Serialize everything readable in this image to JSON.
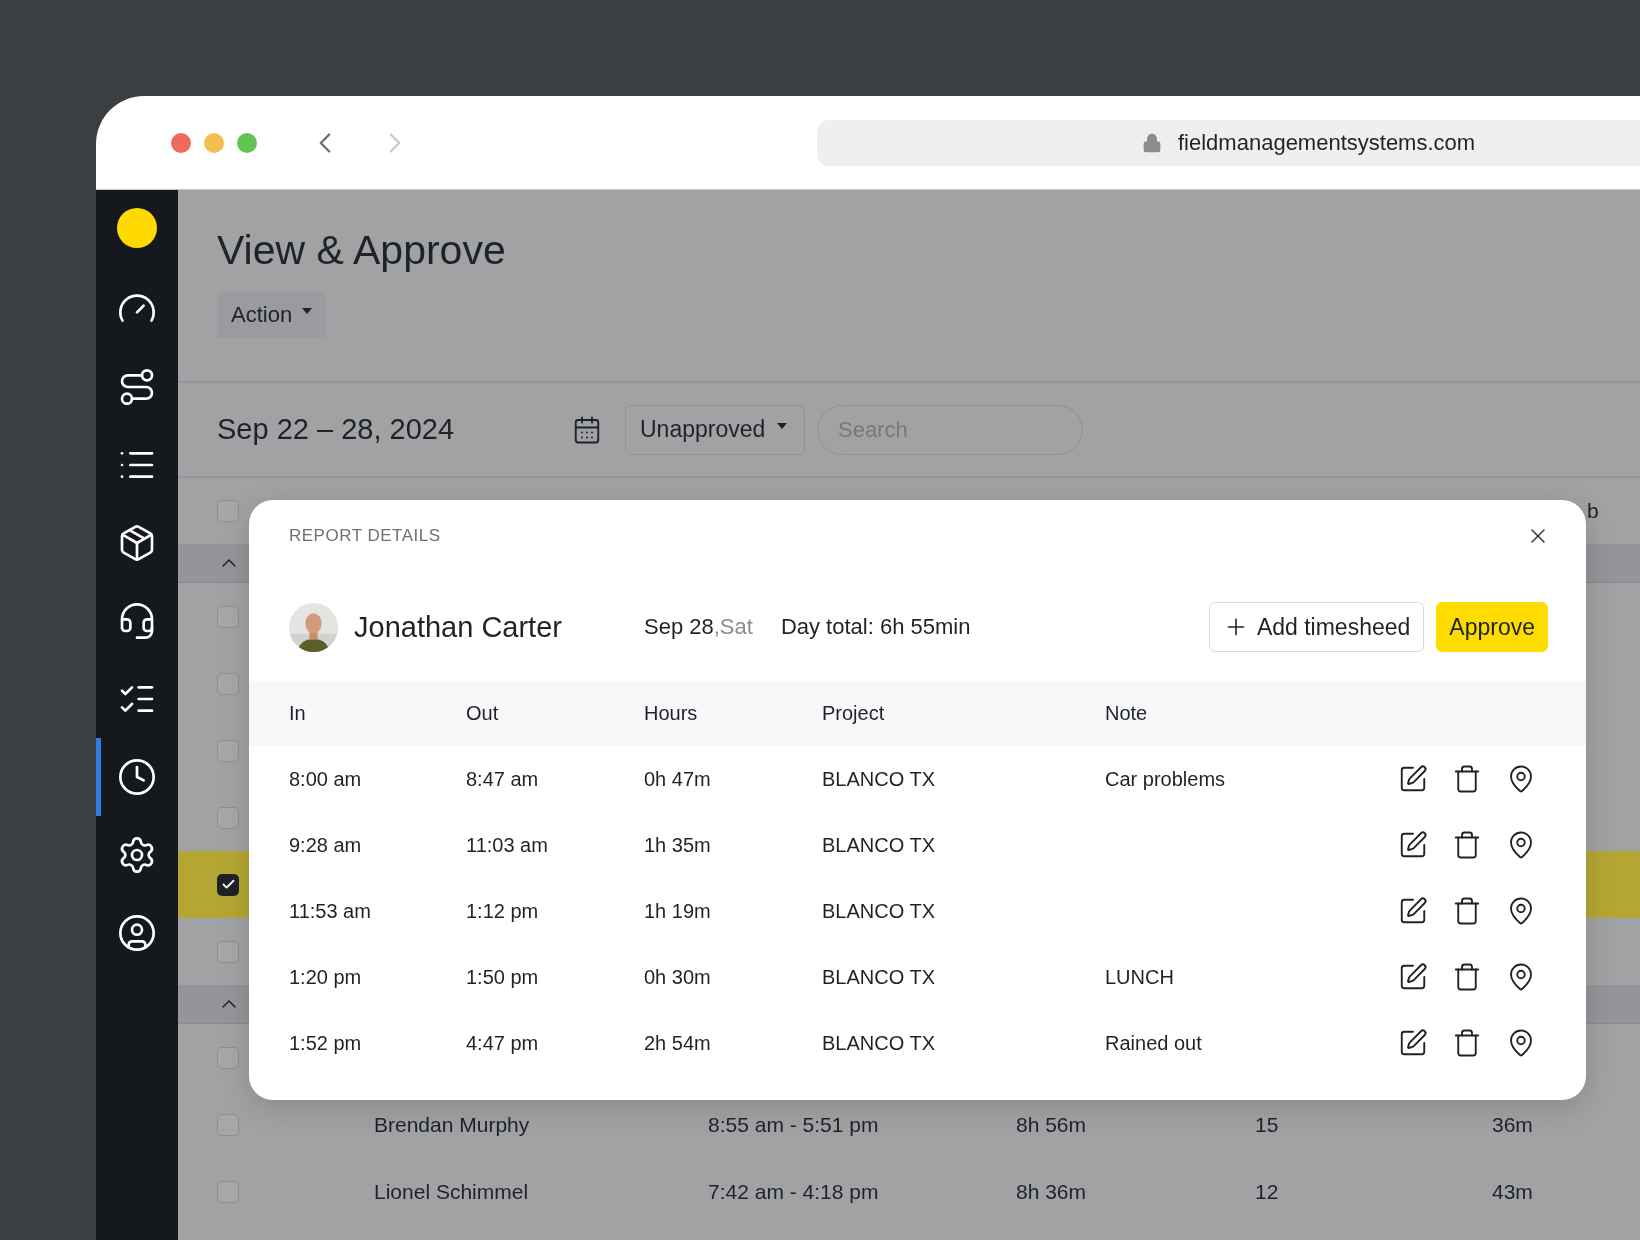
{
  "browser": {
    "url": "fieldmanagementsystems.com"
  },
  "sidebar": {
    "items": [
      {
        "kind": "dashboard",
        "selected": false
      },
      {
        "kind": "route",
        "selected": false
      },
      {
        "kind": "list",
        "selected": false
      },
      {
        "kind": "package",
        "selected": false
      },
      {
        "kind": "support",
        "selected": false
      },
      {
        "kind": "checklist",
        "selected": false
      },
      {
        "kind": "timesheet",
        "selected": true
      },
      {
        "kind": "settings",
        "selected": false
      },
      {
        "kind": "account",
        "selected": false
      }
    ]
  },
  "page": {
    "title": "View & Approve",
    "action_button": "Action"
  },
  "toolbar": {
    "date_range": "Sep 22 – 28, 2024",
    "status_filter": "Unapproved",
    "search": {
      "placeholder": "Search"
    }
  },
  "table": {
    "rows": [
      {
        "kind": "header",
        "checked": false,
        "label": "b"
      },
      {
        "kind": "group",
        "expanded": true
      },
      {
        "kind": "row",
        "checked": false,
        "selected": false
      },
      {
        "kind": "row",
        "checked": false,
        "selected": false
      },
      {
        "kind": "row",
        "checked": false,
        "selected": false
      },
      {
        "kind": "row",
        "checked": false,
        "selected": false
      },
      {
        "kind": "row",
        "checked": true,
        "selected": true
      },
      {
        "kind": "row",
        "checked": false,
        "selected": false
      },
      {
        "kind": "group",
        "expanded": true
      },
      {
        "kind": "row",
        "checked": false,
        "selected": false
      },
      {
        "kind": "row",
        "checked": false,
        "selected": false,
        "name": "Brendan Murphy",
        "time_range": "8:55 am - 5:51 pm",
        "hours": "8h 56m",
        "column_4": "15",
        "column_5": "36m"
      },
      {
        "kind": "row",
        "checked": false,
        "selected": false,
        "name": "Lionel Schimmel",
        "time_range": "7:42 am - 4:18 pm",
        "hours": "8h 36m",
        "column_4": "12",
        "column_5": "43m"
      }
    ]
  },
  "modal": {
    "title": "REPORT DETAILS",
    "employee": {
      "name": "Jonathan Carter"
    },
    "date": "Sep 28",
    "weekday": ",Sat",
    "day_total": "Day total: 6h 55min",
    "buttons": {
      "add": "Add timesheed",
      "approve": "Approve"
    },
    "columns": [
      "In",
      "Out",
      "Hours",
      "Project",
      "Note"
    ],
    "entries": [
      {
        "in": "8:00 am",
        "out": "8:47 am",
        "hours": "0h 47m",
        "project": "BLANCO TX",
        "note": "Car problems"
      },
      {
        "in": "9:28 am",
        "out": "11:03 am",
        "hours": "1h 35m",
        "project": "BLANCO TX"
      },
      {
        "in": "11:53 am",
        "out": "1:12 pm",
        "hours": "1h 19m",
        "project": "BLANCO TX"
      },
      {
        "in": "1:20 pm",
        "out": "1:50 pm",
        "hours": "0h 30m",
        "project": "BLANCO TX",
        "note": "LUNCH"
      },
      {
        "in": "1:52 pm",
        "out": "4:47 pm",
        "hours": "2h 54m",
        "project": "BLANCO TX",
        "note": "Rained out"
      }
    ]
  }
}
